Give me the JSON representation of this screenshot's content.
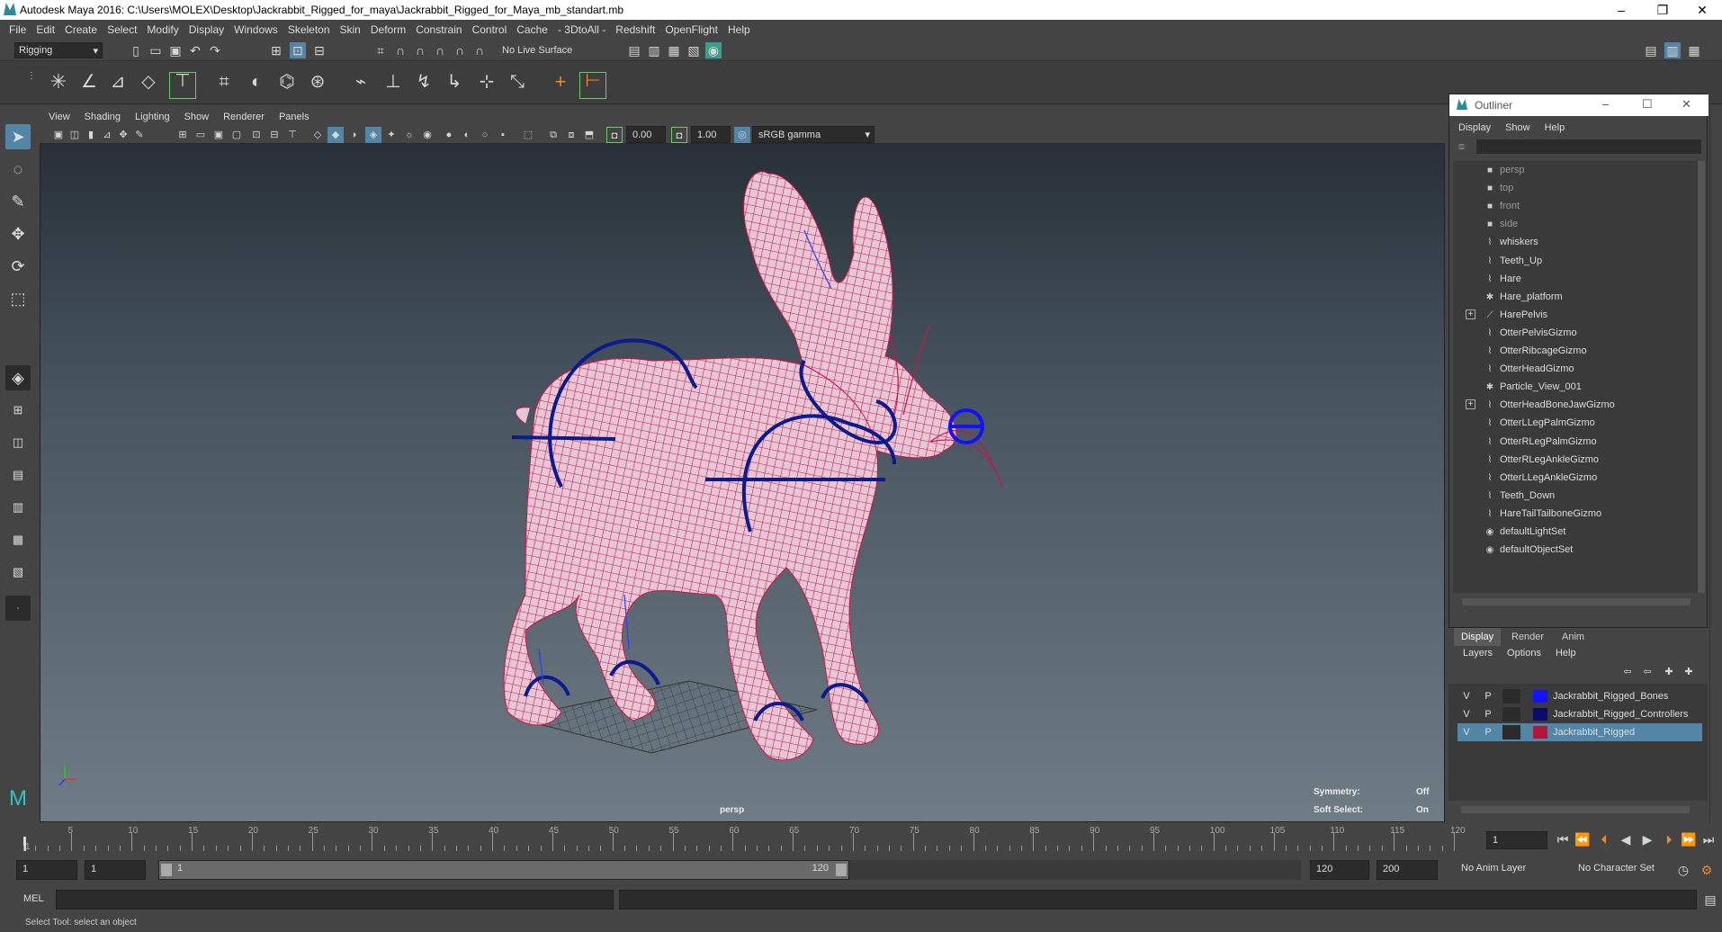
{
  "window": {
    "title": "Autodesk Maya 2016: C:\\Users\\MOLEX\\Desktop\\Jackrabbit_Rigged_for_maya\\Jackrabbit_Rigged_for_Maya_mb_standart.mb",
    "minimize": "–",
    "restore": "❐",
    "close": "✕"
  },
  "menu": [
    "File",
    "Edit",
    "Create",
    "Select",
    "Modify",
    "Display",
    "Windows",
    "Skeleton",
    "Skin",
    "Deform",
    "Constrain",
    "Control",
    "Cache",
    "- 3DtoAll -",
    "Redshift",
    "OpenFlight",
    "Help"
  ],
  "shelf": {
    "mode": "Rigging",
    "live_surface": "No Live Surface"
  },
  "viewport": {
    "menu": [
      "View",
      "Shading",
      "Lighting",
      "Show",
      "Renderer",
      "Panels"
    ],
    "exposure": "0.00",
    "gamma": "1.00",
    "color_space": "sRGB gamma",
    "camera_label": "persp",
    "hud": {
      "symmetry_label": "Symmetry:",
      "symmetry_value": "Off",
      "soft_select_label": "Soft Select:",
      "soft_select_value": "On"
    }
  },
  "outliner": {
    "title": "Outliner",
    "menu": [
      "Display",
      "Show",
      "Help"
    ],
    "items": [
      {
        "label": "persp",
        "icon": "camera-icon",
        "dim": true,
        "expand": false
      },
      {
        "label": "top",
        "icon": "camera-icon",
        "dim": true,
        "expand": false
      },
      {
        "label": "front",
        "icon": "camera-icon",
        "dim": true,
        "expand": false
      },
      {
        "label": "side",
        "icon": "camera-icon",
        "dim": true,
        "expand": false
      },
      {
        "label": "whiskers",
        "icon": "curve-icon",
        "dim": false,
        "expand": false
      },
      {
        "label": "Teeth_Up",
        "icon": "curve-icon",
        "dim": false,
        "expand": false
      },
      {
        "label": "Hare",
        "icon": "curve-icon",
        "dim": false,
        "expand": false
      },
      {
        "label": "Hare_platform",
        "icon": "asterisk-icon",
        "dim": false,
        "expand": false
      },
      {
        "label": "HarePelvis",
        "icon": "joint-icon",
        "dim": false,
        "expand": true
      },
      {
        "label": "OtterPelvisGizmo",
        "icon": "curve-icon",
        "dim": false,
        "expand": false
      },
      {
        "label": "OtterRibcageGizmo",
        "icon": "curve-icon",
        "dim": false,
        "expand": false
      },
      {
        "label": "OtterHeadGizmo",
        "icon": "curve-icon",
        "dim": false,
        "expand": false
      },
      {
        "label": "Particle_View_001",
        "icon": "asterisk-icon",
        "dim": false,
        "expand": false
      },
      {
        "label": "OtterHeadBoneJawGizmo",
        "icon": "curve-icon",
        "dim": false,
        "expand": true
      },
      {
        "label": "OtterLLegPalmGizmo",
        "icon": "curve-icon",
        "dim": false,
        "expand": false
      },
      {
        "label": "OtterRLegPalmGizmo",
        "icon": "curve-icon",
        "dim": false,
        "expand": false
      },
      {
        "label": "OtterRLegAnkleGizmo",
        "icon": "curve-icon",
        "dim": false,
        "expand": false
      },
      {
        "label": "OtterLLegAnkleGizmo",
        "icon": "curve-icon",
        "dim": false,
        "expand": false
      },
      {
        "label": "Teeth_Down",
        "icon": "curve-icon",
        "dim": false,
        "expand": false
      },
      {
        "label": "HareTailTailboneGizmo",
        "icon": "curve-icon",
        "dim": false,
        "expand": false
      },
      {
        "label": "defaultLightSet",
        "icon": "set-icon",
        "dim": false,
        "expand": false
      },
      {
        "label": "defaultObjectSet",
        "icon": "set-icon",
        "dim": false,
        "expand": false
      }
    ]
  },
  "layer_editor": {
    "tabs": [
      "Display",
      "Render",
      "Anim"
    ],
    "menu": [
      "Layers",
      "Options",
      "Help"
    ],
    "layers": [
      {
        "v": "V",
        "p": "P",
        "name": "Jackrabbit_Rigged_Bones",
        "color": "#1212ff",
        "selected": false
      },
      {
        "v": "V",
        "p": "P",
        "name": "Jackrabbit_Rigged_Controllers",
        "color": "#0a0a6e",
        "selected": false
      },
      {
        "v": "V",
        "p": "P",
        "name": "Jackrabbit_Rigged",
        "color": "#b0163a",
        "selected": true
      }
    ]
  },
  "timeline": {
    "ticks": [
      "5",
      "10",
      "15",
      "20",
      "25",
      "30",
      "35",
      "40",
      "45",
      "50",
      "55",
      "60",
      "65",
      "70",
      "75",
      "80",
      "85",
      "90",
      "95",
      "100",
      "105",
      "110",
      "115",
      "120"
    ],
    "start_tick": "1",
    "current_frame": "1"
  },
  "range": {
    "start": "1",
    "playback_start": "1",
    "slider_start": "1",
    "slider_end": "120",
    "playback_end": "120",
    "end": "200",
    "anim_layer": "No Anim Layer",
    "character_set": "No Character Set"
  },
  "command_line": {
    "label": "MEL"
  },
  "help_line": "Select Tool: select an object",
  "colors": {
    "mesh": "#c8144a",
    "rig": "#0b1a8c",
    "accent": "#5285a6"
  }
}
